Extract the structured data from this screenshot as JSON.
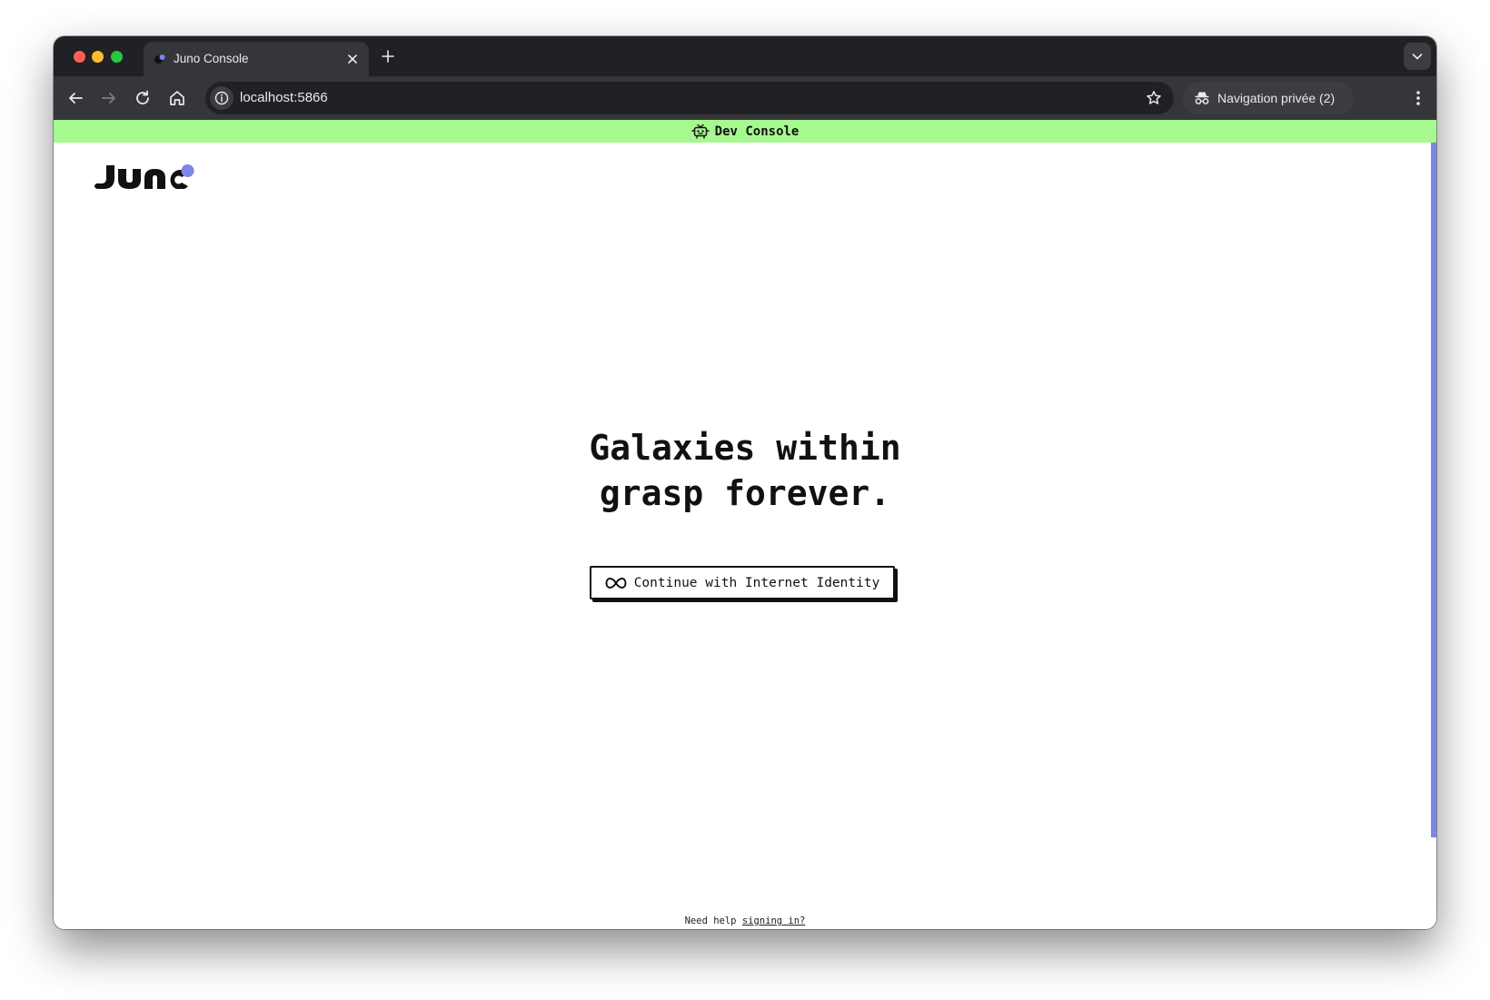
{
  "browser": {
    "tab_title": "Juno Console",
    "url": "localhost:5866",
    "incognito_label": "Navigation privée (2)",
    "icons": [
      "close-icon",
      "plus-icon",
      "back-arrow-icon",
      "forward-arrow-icon",
      "reload-icon",
      "home-icon",
      "info-icon",
      "star-icon",
      "incognito-icon",
      "more-vert-icon",
      "chevron-down-icon"
    ]
  },
  "devbar": {
    "label": "Dev Console",
    "color": "#a6f98f"
  },
  "hero": {
    "line1": "Galaxies within",
    "line2": "grasp forever."
  },
  "login": {
    "button_label": "Continue with Internet Identity"
  },
  "help": {
    "prefix": "Need help",
    "link": "signing in?"
  },
  "colors": {
    "accent": "#7b86e8",
    "text": "#111111"
  }
}
